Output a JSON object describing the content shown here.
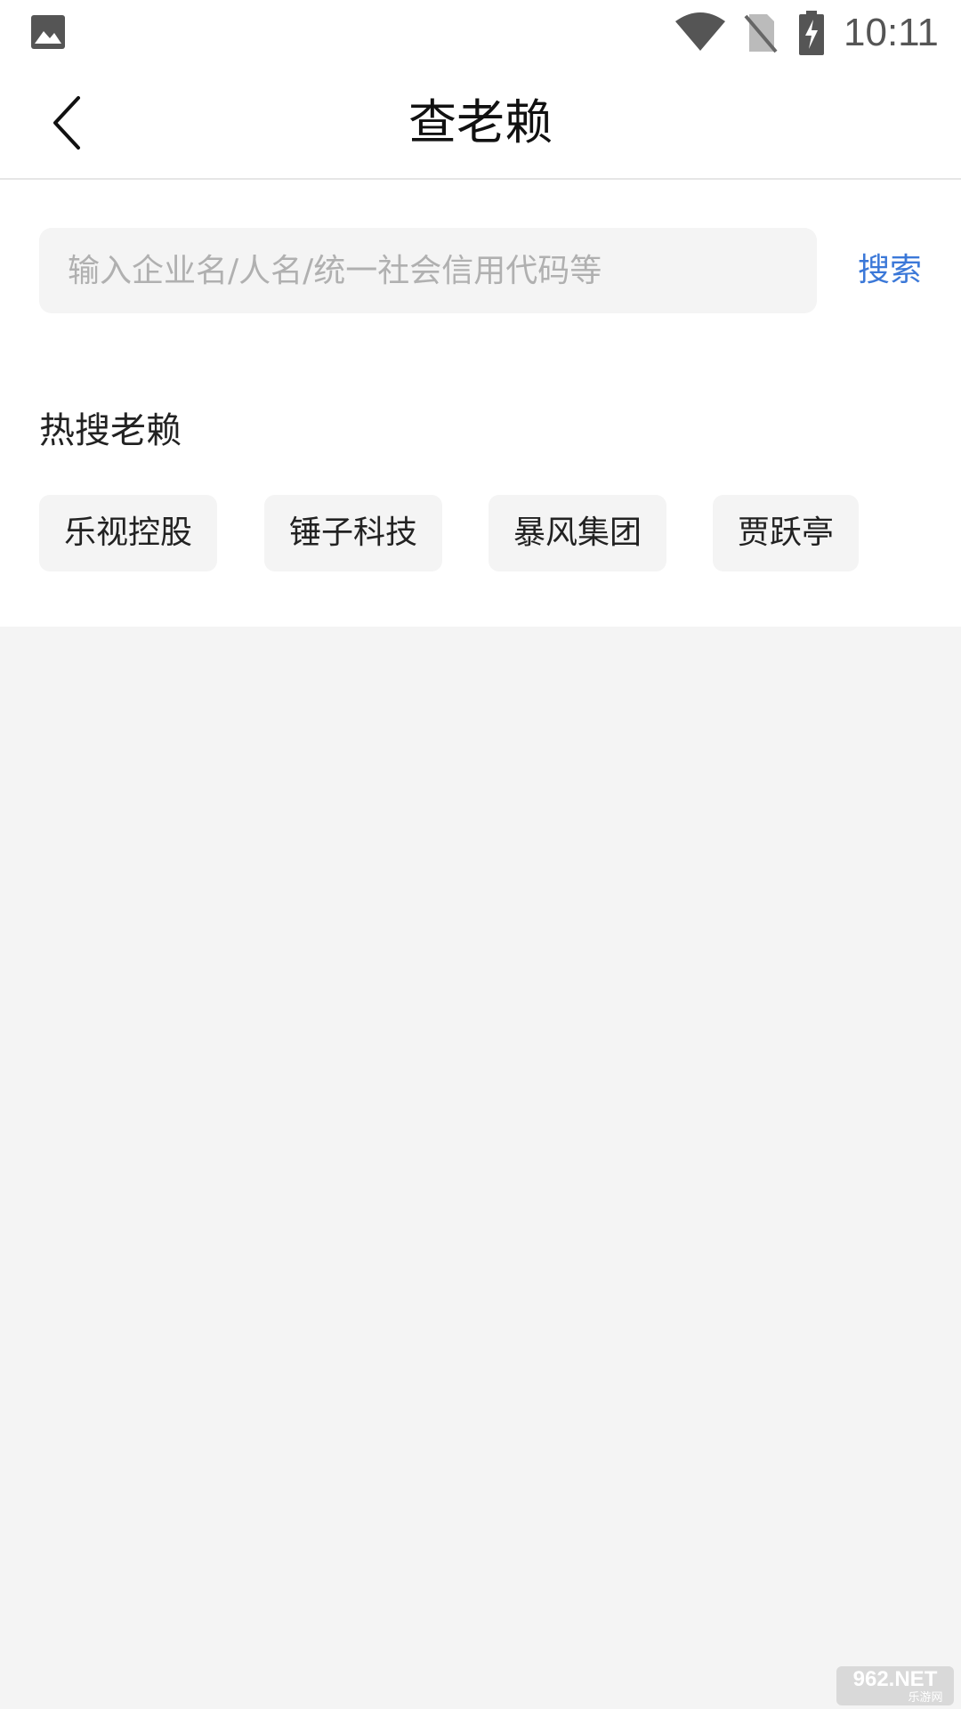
{
  "status_bar": {
    "time": "10:11",
    "icons": [
      "gallery-icon",
      "wifi-icon",
      "no-sim-icon",
      "battery-charging-icon"
    ]
  },
  "header": {
    "back_icon": "chevron-left-icon",
    "title": "查老赖"
  },
  "search": {
    "placeholder": "输入企业名/人名/统一社会信用代码等",
    "value": "",
    "button_label": "搜索"
  },
  "hot": {
    "title": "热搜老赖",
    "tags": [
      "乐视控股",
      "锤子科技",
      "暴风集团",
      "贾跃亭"
    ]
  },
  "watermark": {
    "text": "962.NET",
    "subtext": "乐游网"
  },
  "colors": {
    "accent": "#3b78d8",
    "page_background": "#f4f4f4",
    "card_background": "#ffffff"
  }
}
